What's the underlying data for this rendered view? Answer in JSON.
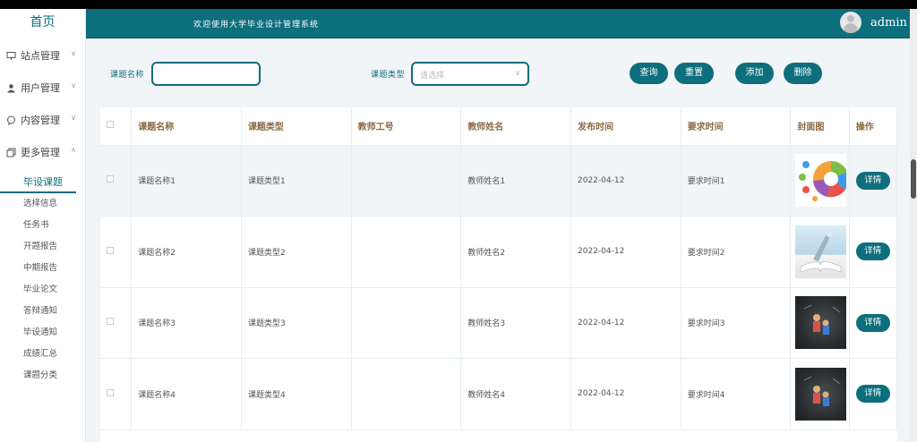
{
  "sidebar": {
    "home": "首页",
    "menus": [
      {
        "label": "站点管理",
        "icon": "monitor-icon",
        "expanded": false
      },
      {
        "label": "用户管理",
        "icon": "user-icon",
        "expanded": false
      },
      {
        "label": "内容管理",
        "icon": "message-icon",
        "expanded": false
      },
      {
        "label": "更多管理",
        "icon": "copy-icon",
        "expanded": true
      }
    ],
    "sub_items": [
      "毕设课题",
      "选择信息",
      "任务书",
      "开题报告",
      "中期报告",
      "毕业论文",
      "答辩通知",
      "毕设通知",
      "成绩汇总",
      "课题分类"
    ],
    "active_sub_index": 0
  },
  "header": {
    "title": "欢迎使用大学毕业设计管理系统",
    "username": "admin"
  },
  "search": {
    "topic_name_label": "课题名称",
    "topic_name_value": "",
    "topic_type_label": "课题类型",
    "topic_type_placeholder": "请选择"
  },
  "buttons": {
    "query": "查询",
    "reset": "重置",
    "add": "添加",
    "delete": "删除"
  },
  "table": {
    "columns": [
      "课题名称",
      "课题类型",
      "教师工号",
      "教师姓名",
      "发布时间",
      "要求时间",
      "封面图",
      "操作"
    ],
    "detail_label": "详情",
    "rows": [
      {
        "name": "课题名称1",
        "type": "课题类型1",
        "teacher_id": "",
        "teacher_name": "教师姓名1",
        "publish_date": "2022-04-12",
        "required_time": "要求时间1",
        "cover": "infographic-thumb"
      },
      {
        "name": "课题名称2",
        "type": "课题类型2",
        "teacher_id": "",
        "teacher_name": "教师姓名2",
        "publish_date": "2022-04-12",
        "required_time": "要求时间2",
        "cover": "book-thumb"
      },
      {
        "name": "课题名称3",
        "type": "课题类型3",
        "teacher_id": "",
        "teacher_name": "教师姓名3",
        "publish_date": "2022-04-12",
        "required_time": "要求时间3",
        "cover": "chalkboard-thumb"
      },
      {
        "name": "课题名称4",
        "type": "课题类型4",
        "teacher_id": "",
        "teacher_name": "教师姓名4",
        "publish_date": "2022-04-12",
        "required_time": "要求时间4",
        "cover": "chalkboard-thumb"
      }
    ]
  },
  "colors": {
    "primary": "#0d6e7c",
    "header_text_column": "#8b6a45"
  }
}
